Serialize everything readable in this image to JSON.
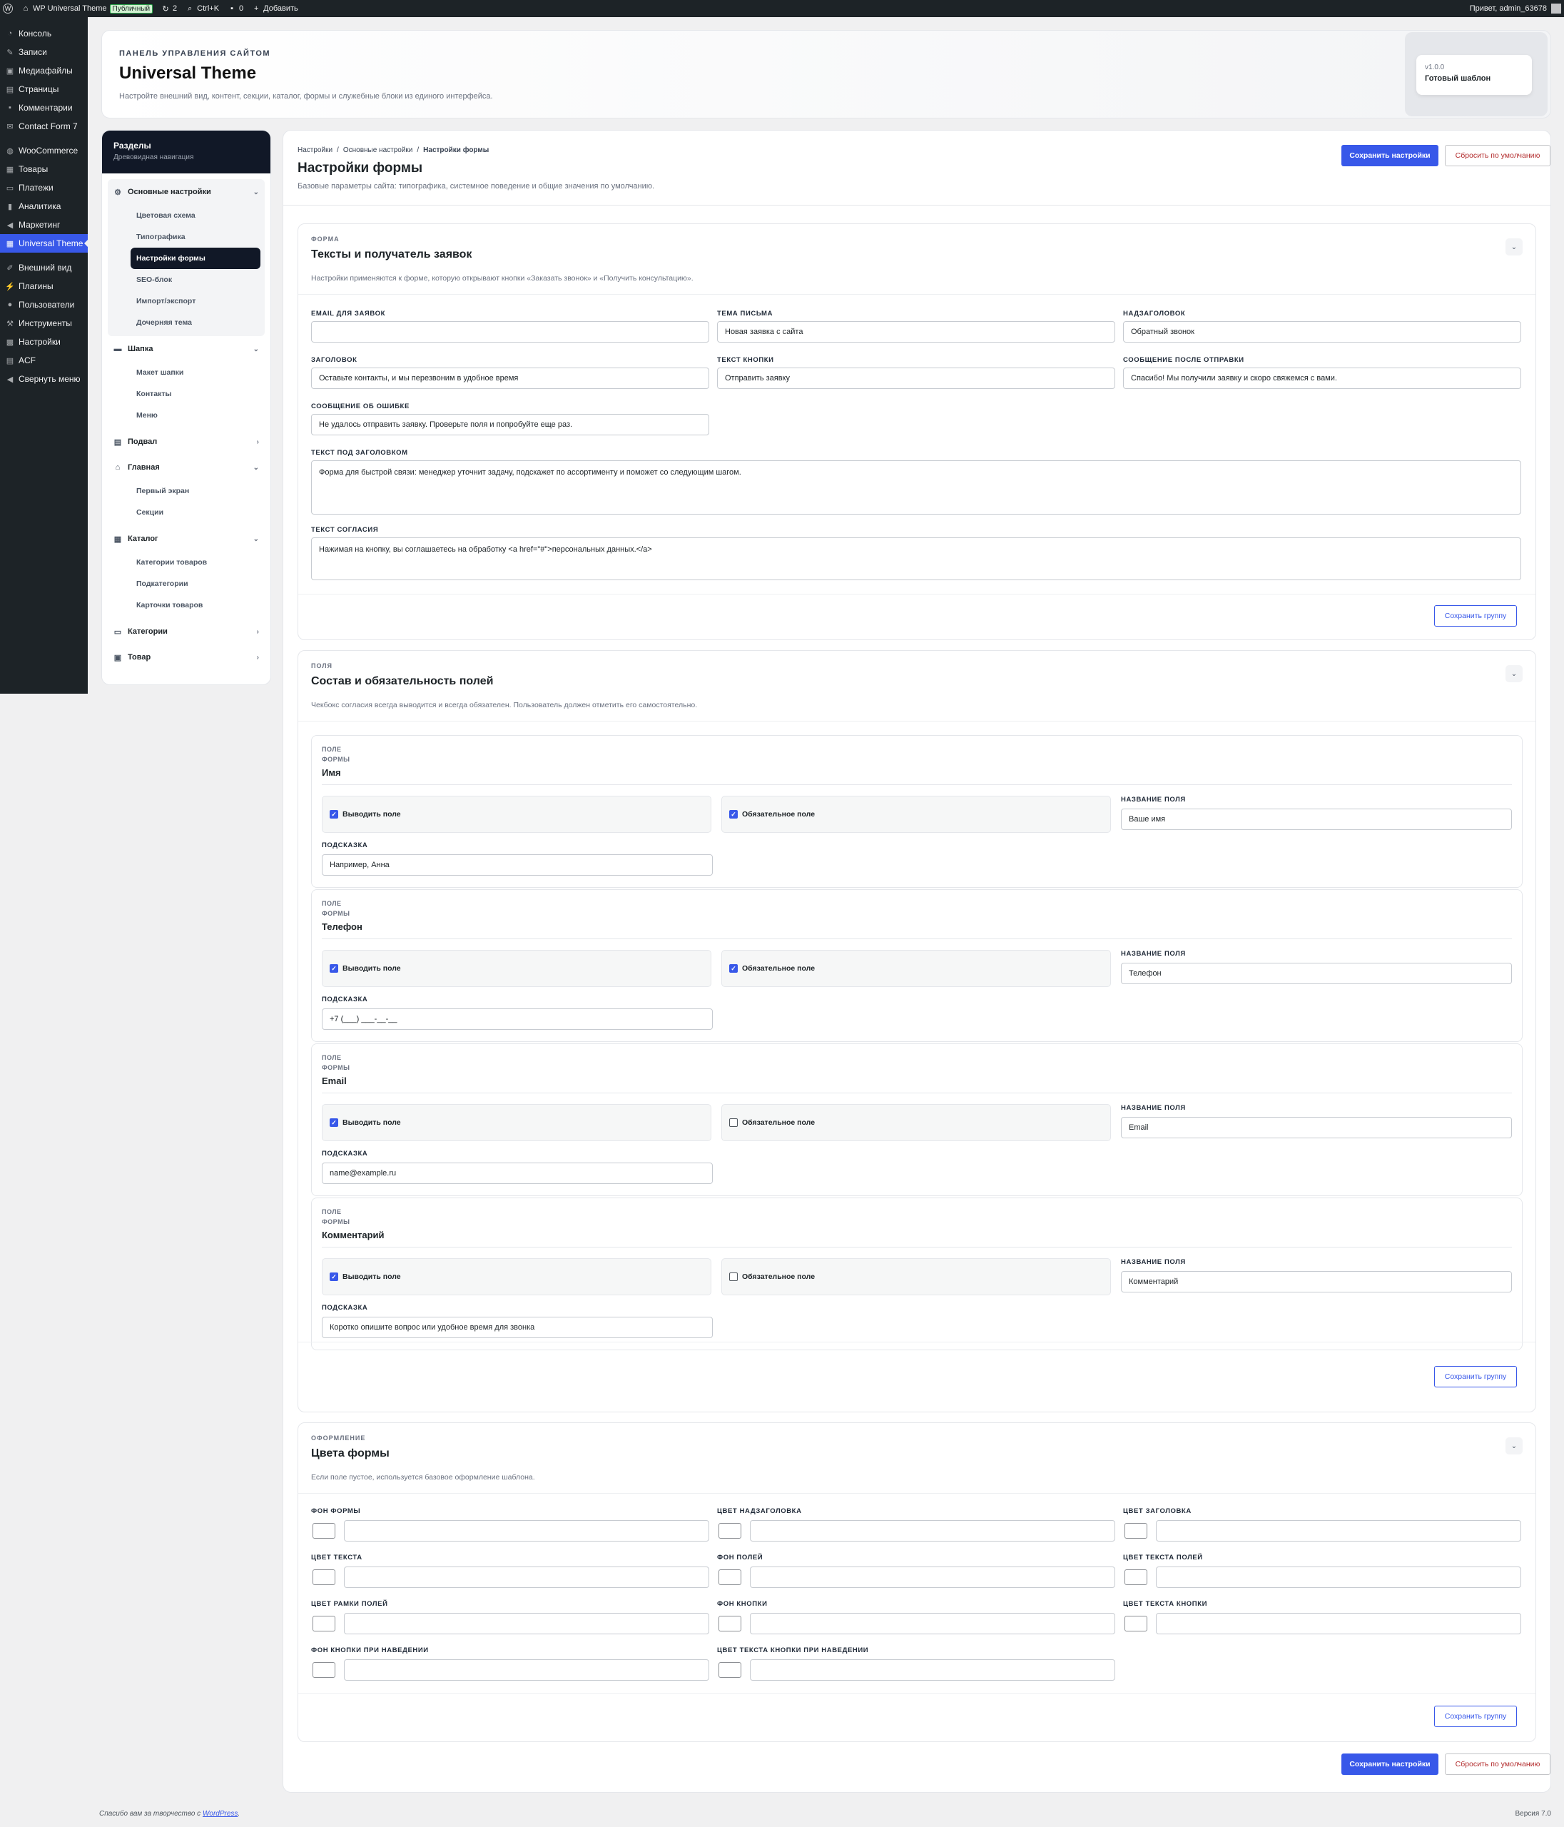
{
  "adminbar": {
    "site": "WP Universal Theme",
    "badge": "Публичный",
    "updates": "2",
    "search": "Ctrl+K",
    "comments": "0",
    "add": "Добавить",
    "greeting": "Привет, admin_63678"
  },
  "wpmenu": [
    {
      "label": "Консоль",
      "icon": "dashboard-icon"
    },
    {
      "label": "Записи",
      "icon": "pin-icon"
    },
    {
      "label": "Медиафайлы",
      "icon": "media-icon"
    },
    {
      "label": "Страницы",
      "icon": "page-icon"
    },
    {
      "label": "Комментарии",
      "icon": "comment-icon"
    },
    {
      "label": "Contact Form 7",
      "icon": "mail-icon"
    },
    {
      "label": "WooCommerce",
      "icon": "woo-icon"
    },
    {
      "label": "Товары",
      "icon": "archive-icon"
    },
    {
      "label": "Платежи",
      "icon": "payments-icon"
    },
    {
      "label": "Аналитика",
      "icon": "chart-icon"
    },
    {
      "label": "Маркетинг",
      "icon": "megaphone-icon"
    },
    {
      "label": "Universal Theme",
      "icon": "grid-icon"
    },
    {
      "label": "Внешний вид",
      "icon": "brush-icon"
    },
    {
      "label": "Плагины",
      "icon": "plugin-icon"
    },
    {
      "label": "Пользователи",
      "icon": "user-icon"
    },
    {
      "label": "Инструменты",
      "icon": "wrench-icon"
    },
    {
      "label": "Настройки",
      "icon": "settings-icon"
    },
    {
      "label": "ACF",
      "icon": "table-icon"
    },
    {
      "label": "Свернуть меню",
      "icon": "collapse-icon"
    }
  ],
  "hero": {
    "kicker": "ПАНЕЛЬ УПРАВЛЕНИЯ САЙТОМ",
    "title": "Universal Theme",
    "desc": "Настройте внешний вид, контент, секции, каталог, формы и служебные блоки из единого интерфейса.",
    "version": "v1.0.0",
    "version_label": "Готовый шаблон"
  },
  "sidebar": {
    "title": "Разделы",
    "subtitle": "Древовидная навигация",
    "groups": [
      {
        "label": "Основные настройки",
        "items": [
          "Цветовая схема",
          "Типографика",
          "Настройки формы",
          "SEO-блок",
          "Импорт/экспорт",
          "Дочерняя тема"
        ]
      },
      {
        "label": "Шапка",
        "items": [
          "Макет шапки",
          "Контакты",
          "Меню"
        ]
      },
      {
        "label": "Подвал",
        "items": []
      },
      {
        "label": "Главная",
        "items": [
          "Первый экран",
          "Секции"
        ]
      },
      {
        "label": "Каталог",
        "items": [
          "Категории товаров",
          "Подкатегории",
          "Карточки товаров"
        ]
      },
      {
        "label": "Категории",
        "items": []
      },
      {
        "label": "Товар",
        "items": []
      }
    ]
  },
  "main": {
    "breadcrumb": [
      "Настройки",
      "Основные настройки",
      "Настройки формы"
    ],
    "title": "Настройки формы",
    "desc": "Базовые параметры сайта: типографика, системное поведение и общие значения по умолчанию.",
    "save": "Сохранить настройки",
    "reset": "Сбросить по умолчанию",
    "save_group": "Сохранить группу"
  },
  "form_card": {
    "kicker": "ФОРМА",
    "title": "Тексты и получатель заявок",
    "desc": "Настройки применяются к форме, которую открывают кнопки «Заказать звонок» и «Получить консультацию».",
    "fields": {
      "email": {
        "label": "EMAIL ДЛЯ ЗАЯВОК",
        "value": ""
      },
      "subject": {
        "label": "ТЕМА ПИСЬМА",
        "value": "Новая заявка с сайта"
      },
      "overtitle": {
        "label": "НАДЗАГОЛОВОК",
        "value": "Обратный звонок"
      },
      "heading": {
        "label": "ЗАГОЛОВОК",
        "value": "Оставьте контакты, и мы перезвоним в удобное время"
      },
      "button": {
        "label": "ТЕКСТ КНОПКИ",
        "value": "Отправить заявку"
      },
      "success": {
        "label": "СООБЩЕНИЕ ПОСЛЕ ОТПРАВКИ",
        "value": "Спасибо! Мы получили заявку и скоро свяжемся с вами."
      },
      "error": {
        "label": "СООБЩЕНИЕ ОБ ОШИБКЕ",
        "value": "Не удалось отправить заявку. Проверьте поля и попробуйте еще раз."
      },
      "subtitle": {
        "label": "ТЕКСТ ПОД ЗАГОЛОВКОМ",
        "value": "Форма для быстрой связи: менеджер уточнит задачу, подскажет по ассортименту и поможет со следующим шагом."
      },
      "consent": {
        "label": "ТЕКСТ СОГЛАСИЯ",
        "value": "Нажимая на кнопку, вы соглашаетесь на обработку <a href=\"#\">персональных данных.</a>"
      }
    }
  },
  "fields_card": {
    "kicker": "ПОЛЯ",
    "title": "Состав и обязательность полей",
    "desc": "Чекбокс согласия всегда выводится и всегда обязателен. Пользователь должен отметить его самостоятельно.",
    "kicker1": "ПОЛЕ",
    "kicker2": "ФОРМЫ",
    "show_label": "Выводить поле",
    "required_label": "Обязательное поле",
    "name_label": "НАЗВАНИЕ ПОЛЯ",
    "hint_label": "ПОДСКАЗКА",
    "items": [
      {
        "name": "Имя",
        "show": true,
        "required": true,
        "field_name": "Ваше имя",
        "hint": "Например, Анна"
      },
      {
        "name": "Телефон",
        "show": true,
        "required": true,
        "field_name": "Телефон",
        "hint": "+7 (___) ___-__-__"
      },
      {
        "name": "Email",
        "show": true,
        "required": false,
        "field_name": "Email",
        "hint": "name@example.ru"
      },
      {
        "name": "Комментарий",
        "show": true,
        "required": false,
        "field_name": "Комментарий",
        "hint": "Коротко опишите вопрос или удобное время для звонка"
      }
    ]
  },
  "colors_card": {
    "kicker": "ОФОРМЛЕНИЕ",
    "title": "Цвета формы",
    "desc": "Если поле пустое, используется базовое оформление шаблона.",
    "fields": [
      "ФОН ФОРМЫ",
      "ЦВЕТ НАДЗАГОЛОВКА",
      "ЦВЕТ ЗАГОЛОВКА",
      "ЦВЕТ ТЕКСТА",
      "ФОН ПОЛЕЙ",
      "ЦВЕТ ТЕКСТА ПОЛЕЙ",
      "ЦВЕТ РАМКИ ПОЛЕЙ",
      "ФОН КНОПКИ",
      "ЦВЕТ ТЕКСТА КНОПКИ",
      "ФОН КНОПКИ ПРИ НАВЕДЕНИИ",
      "ЦВЕТ ТЕКСТА КНОПКИ ПРИ НАВЕДЕНИИ"
    ]
  },
  "footer": {
    "thanks": "Спасибо вам за творчество с",
    "link": "WordPress",
    "version": "Версия 7.0"
  },
  "colors": {
    "accent": "#3858e9",
    "adminbar": "#1d2327",
    "danger": "#b32d2e"
  }
}
